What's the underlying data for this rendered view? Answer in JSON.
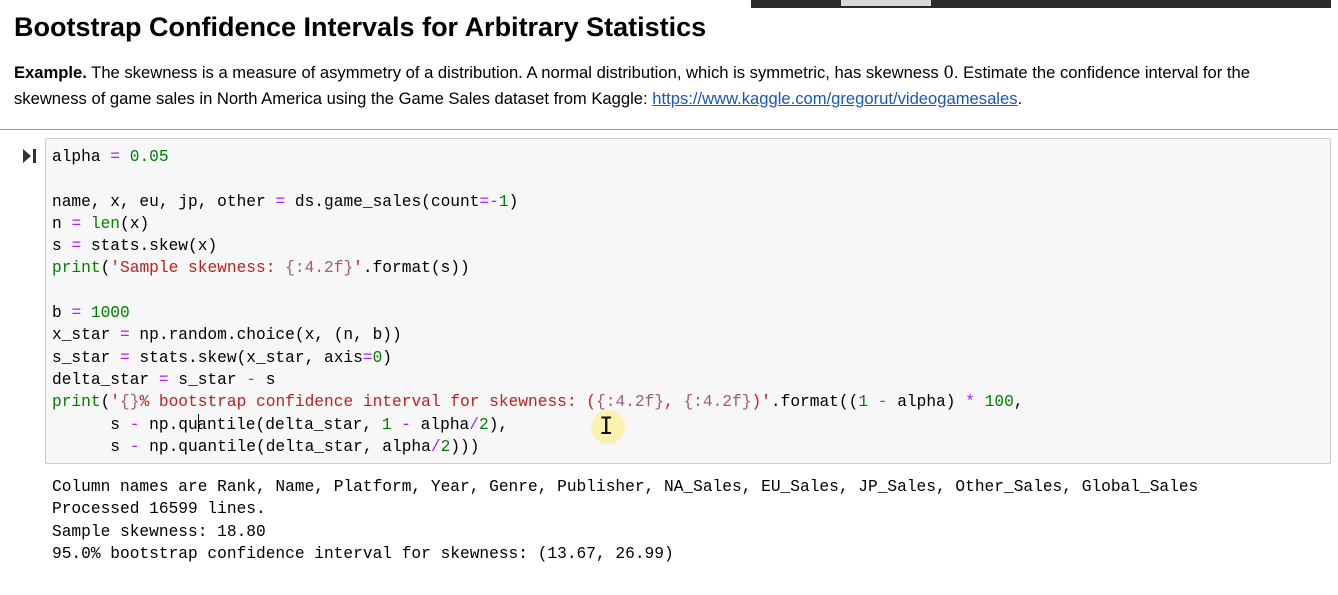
{
  "heading": "Bootstrap Confidence Intervals for Arbitrary Statistics",
  "intro": {
    "label": "Example.",
    "text_1": " The skewness is a measure of asymmetry of a distribution. A normal distribution, which is symmetric, has skewness ",
    "math": "0",
    "text_2": ". Estimate the confidence interval for the skewness of game sales in North America using the Game Sales dataset from Kaggle: ",
    "link": "https://www.kaggle.com/gregorut/videogamesales",
    "text_3": "."
  },
  "cell": {
    "run_icon": "run-cell-icon",
    "code": {
      "l1_var": "alpha ",
      "eq": "=",
      "l1_val": " 0.05",
      "l3_vars": "name, x, eu, jp, other ",
      "l3_call": " ds.game_sales(count",
      "l3_neg": "-",
      "l3_one": "1",
      "close": ")",
      "l4_var": "n ",
      "l4_fn": "len",
      "l4_arg": "(x)",
      "l5_var": "s ",
      "l5_call": " stats.skew(x)",
      "print": "print",
      "l6_open": "(",
      "l6_str1": "'Sample skewness: ",
      "l6_fmt": "{:4.2f}",
      "l6_str2": "'",
      "l6_rest": ".format(s))",
      "l8_var": "b ",
      "l8_val": " 1000",
      "l9_var": "x_star ",
      "l9_call": " np.random.choice(x, (n, b))",
      "l10_var": "s_star ",
      "l10_call": " stats.skew(x_star, axis",
      "l10_zero": "0",
      "l11_var": "delta_star ",
      "l11_mid": " s_star ",
      "minus": "-",
      "l11_end": " s",
      "l12_q1": "'",
      "l12_f1": "{}",
      "l12_s1": "% bootstrap confidence interval for skewness: (",
      "l12_f2": "{:4.2f}",
      "l12_s2": ", ",
      "l12_f3": "{:4.2f}",
      "l12_s3": ")'",
      "l12_fmt": ".format((",
      "l12_one": "1",
      "l12_mid": " alpha) ",
      "mul": "*",
      "l12_hundred": " 100",
      "l12_end": ",",
      "l13_indent": "      s ",
      "l13_a": " np.qu",
      "l13_b": "antile(delta_star, ",
      "l13_one": "1",
      "l13_alpha": " alpha",
      "div": "/",
      "two": "2",
      "l13_end": "),",
      "l14_indent": "      s ",
      "l14_a": " np.quantile(delta_star, alpha",
      "l14_end": ")))"
    },
    "output": "Column names are Rank, Name, Platform, Year, Genre, Publisher, NA_Sales, EU_Sales, JP_Sales, Other_Sales, Global_Sales\nProcessed 16599 lines.\nSample skewness: 18.80\n95.0% bootstrap confidence interval for skewness: (13.67, 26.99)"
  },
  "icons": {
    "cursor": "I"
  },
  "colors": {
    "number": "#008000",
    "operator": "#aa22ff",
    "string": "#ba2121",
    "link": "#1a55b8",
    "cell_border": "#6aaf6a"
  }
}
